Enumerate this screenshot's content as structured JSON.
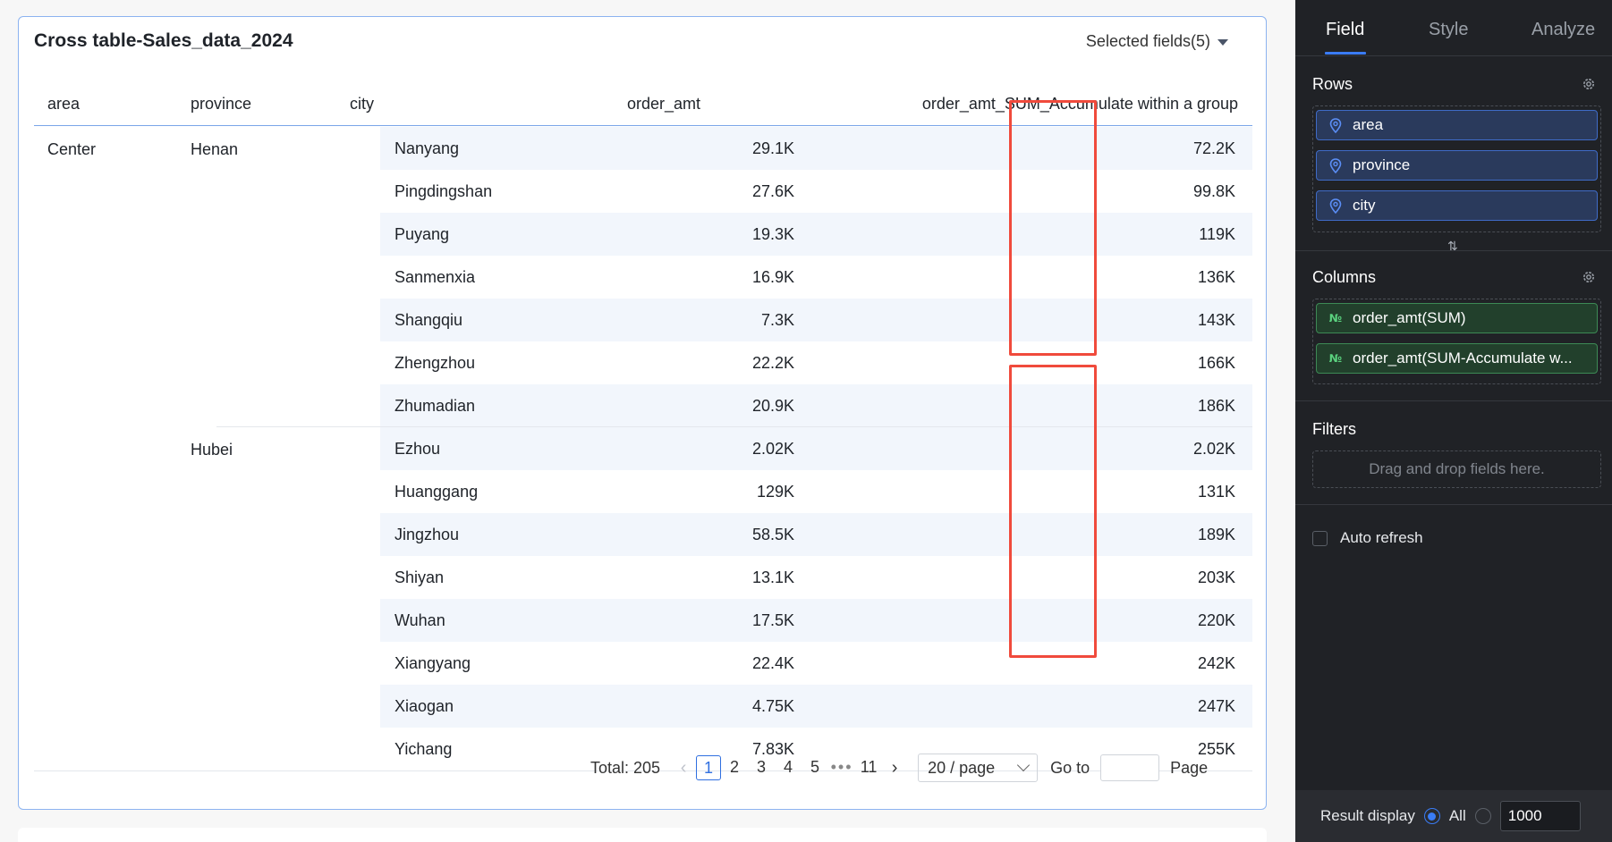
{
  "card": {
    "title": "Cross table-Sales_data_2024",
    "selected_fields": "Selected fields(5)"
  },
  "table": {
    "columns": [
      "area",
      "province",
      "city",
      "order_amt",
      "order_amt_SUM_Accumulate within a group"
    ],
    "area": "Center",
    "groups": [
      {
        "province": "Henan",
        "rows": [
          {
            "city": "Nanyang",
            "order_amt": "29.1K",
            "acc": "72.2K"
          },
          {
            "city": "Pingdingshan",
            "order_amt": "27.6K",
            "acc": "99.8K"
          },
          {
            "city": "Puyang",
            "order_amt": "19.3K",
            "acc": "119K"
          },
          {
            "city": "Sanmenxia",
            "order_amt": "16.9K",
            "acc": "136K"
          },
          {
            "city": "Shangqiu",
            "order_amt": "7.3K",
            "acc": "143K"
          },
          {
            "city": "Zhengzhou",
            "order_amt": "22.2K",
            "acc": "166K"
          },
          {
            "city": "Zhumadian",
            "order_amt": "20.9K",
            "acc": "186K"
          }
        ]
      },
      {
        "province": "Hubei",
        "rows": [
          {
            "city": "Ezhou",
            "order_amt": "2.02K",
            "acc": "2.02K"
          },
          {
            "city": "Huanggang",
            "order_amt": "129K",
            "acc": "131K"
          },
          {
            "city": "Jingzhou",
            "order_amt": "58.5K",
            "acc": "189K"
          },
          {
            "city": "Shiyan",
            "order_amt": "13.1K",
            "acc": "203K"
          },
          {
            "city": "Wuhan",
            "order_amt": "17.5K",
            "acc": "220K"
          },
          {
            "city": "Xiangyang",
            "order_amt": "22.4K",
            "acc": "242K"
          },
          {
            "city": "Xiaogan",
            "order_amt": "4.75K",
            "acc": "247K"
          },
          {
            "city": "Yichang",
            "order_amt": "7.83K",
            "acc": "255K"
          }
        ]
      }
    ]
  },
  "pagination": {
    "total": "Total: 205",
    "pages": [
      "1",
      "2",
      "3",
      "4",
      "5"
    ],
    "dots": "•••",
    "last_page": "11",
    "current": "1",
    "page_size": "20 / page",
    "goto_label": "Go to",
    "page_label": "Page",
    "prev_icon": "‹",
    "next_icon": "›"
  },
  "panel": {
    "tabs": [
      "Field",
      "Style",
      "Analyze"
    ],
    "active_tab": "Field",
    "rows_title": "Rows",
    "rows": [
      "area",
      "province",
      "city"
    ],
    "columns_title": "Columns",
    "columns": [
      "order_amt(SUM)",
      "order_amt(SUM-Accumulate w..."
    ],
    "measure_icon": "№",
    "swap_icon": "⇅",
    "filters_title": "Filters",
    "filters_placeholder": "Drag and drop fields here.",
    "auto_refresh": "Auto refresh",
    "result_display": "Result display",
    "result_all": "All",
    "result_limit": "1000",
    "accent": "#3a7cf5",
    "highlight": "#f04a3c"
  }
}
